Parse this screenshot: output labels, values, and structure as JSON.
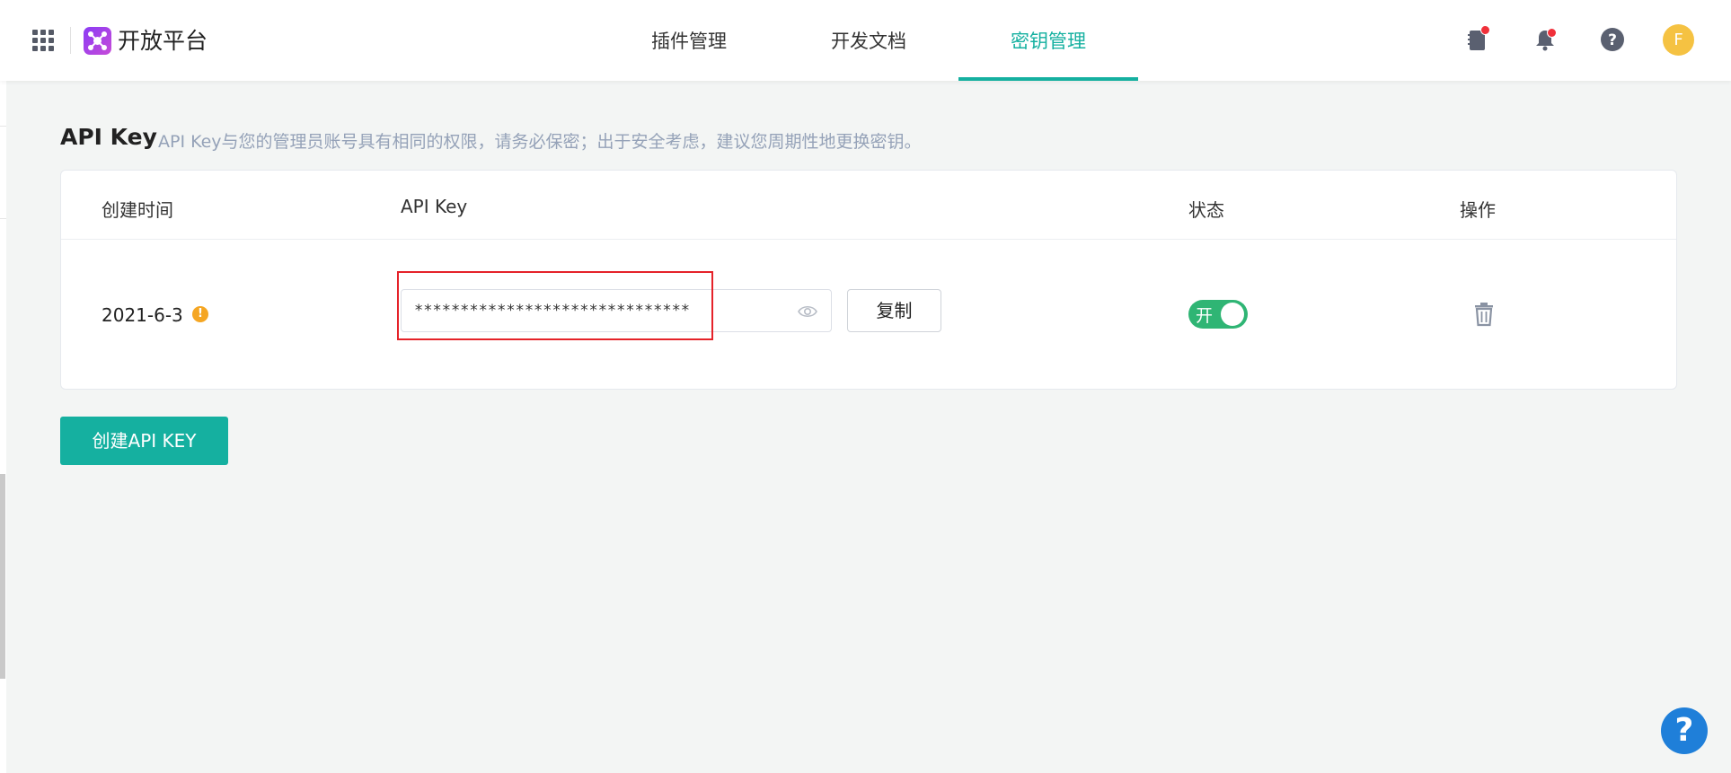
{
  "header": {
    "brand_name": "开放平台",
    "nav": [
      {
        "label": "插件管理",
        "active": false
      },
      {
        "label": "开发文档",
        "active": false
      },
      {
        "label": "密钥管理",
        "active": true
      }
    ],
    "avatar_letter": "F",
    "icons": [
      "apps-grid-icon",
      "notebook-icon",
      "bell-icon",
      "help-icon"
    ]
  },
  "section": {
    "title": "API Key",
    "description": "API Key与您的管理员账号具有相同的权限，请务必保密；出于安全考虑，建议您周期性地更换密钥。"
  },
  "table": {
    "columns": [
      "创建时间",
      "API Key",
      "状态",
      "操作"
    ],
    "rows": [
      {
        "created": "2021-6-3",
        "api_key": "******************************",
        "copy_label": "复制",
        "status_label": "开",
        "status_on": true
      }
    ]
  },
  "actions": {
    "create_label": "创建API KEY"
  },
  "fab": {
    "help_label": "?"
  },
  "colors": {
    "accent": "#15b0a0",
    "toggle_on": "#2fb574",
    "highlight": "#e52229",
    "fab": "#1f7fd9",
    "avatar": "#f5c242"
  }
}
